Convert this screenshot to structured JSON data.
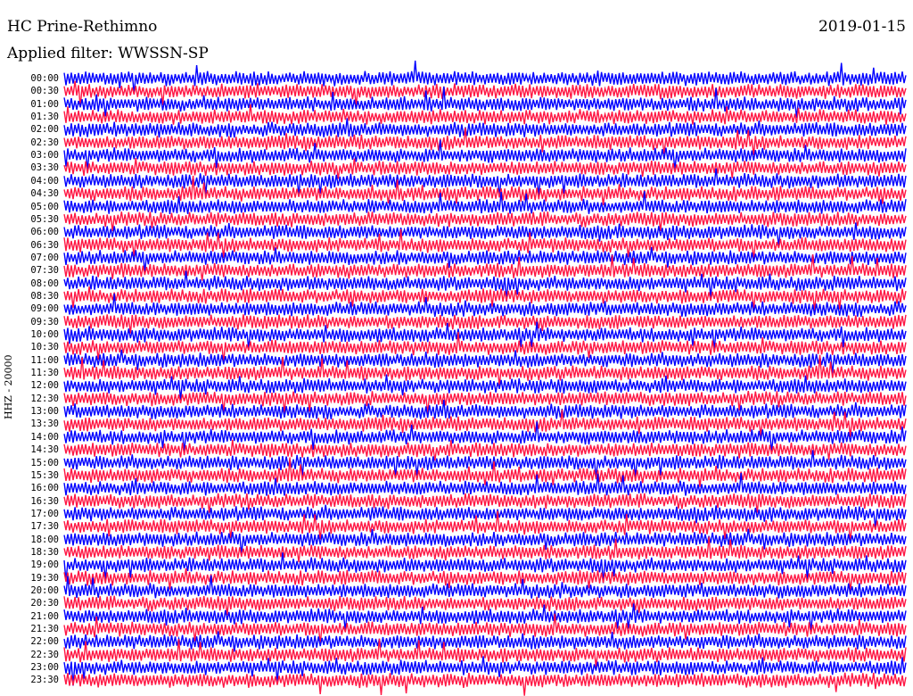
{
  "header": {
    "station": "HC Prine-Rethimno",
    "date": "2019-01-15",
    "filter": "Applied filter: WWSSN-SP"
  },
  "chart_data": {
    "type": "line",
    "title": "HC Prine-Rethimno",
    "subtitle": "Applied filter: WWSSN-SP",
    "ylabel": "HHZ - 20000",
    "xlabel": "",
    "categories": [
      "00:00",
      "00:30",
      "01:00",
      "01:30",
      "02:00",
      "02:30",
      "03:00",
      "03:30",
      "04:00",
      "04:30",
      "05:00",
      "05:30",
      "06:00",
      "06:30",
      "07:00",
      "07:30",
      "08:00",
      "08:30",
      "09:00",
      "09:30",
      "10:00",
      "10:30",
      "11:00",
      "11:30",
      "12:00",
      "12:30",
      "13:00",
      "13:30",
      "14:00",
      "14:30",
      "15:00",
      "15:30",
      "16:00",
      "16:30",
      "17:00",
      "17:30",
      "18:00",
      "18:30",
      "19:00",
      "19:30",
      "20:00",
      "20:30",
      "21:00",
      "21:30",
      "22:00",
      "22:30",
      "23:00",
      "23:30"
    ],
    "colors": [
      "#0000ff",
      "#ff1744"
    ],
    "grid": false,
    "legend": "none"
  }
}
